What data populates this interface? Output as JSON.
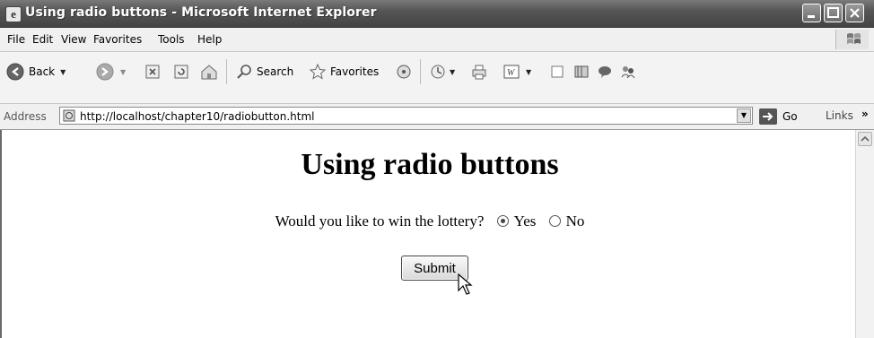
{
  "window": {
    "title": "Using radio buttons - Microsoft Internet Explorer"
  },
  "menu": [
    "File",
    "Edit",
    "View",
    "Favorites",
    "Tools",
    "Help"
  ],
  "toolbar": {
    "back_label": "Back",
    "search_label": "Search",
    "favorites_label": "Favorites"
  },
  "address": {
    "label": "Address",
    "url": "http://localhost/chapter10/radiobutton.html",
    "go_label": "Go",
    "links_label": "Links",
    "links_chevron": "»"
  },
  "page": {
    "heading": "Using radio buttons",
    "question": "Would you like to win the lottery?",
    "options": [
      {
        "label": "Yes",
        "checked": true
      },
      {
        "label": "No",
        "checked": false
      }
    ],
    "submit_label": "Submit"
  }
}
